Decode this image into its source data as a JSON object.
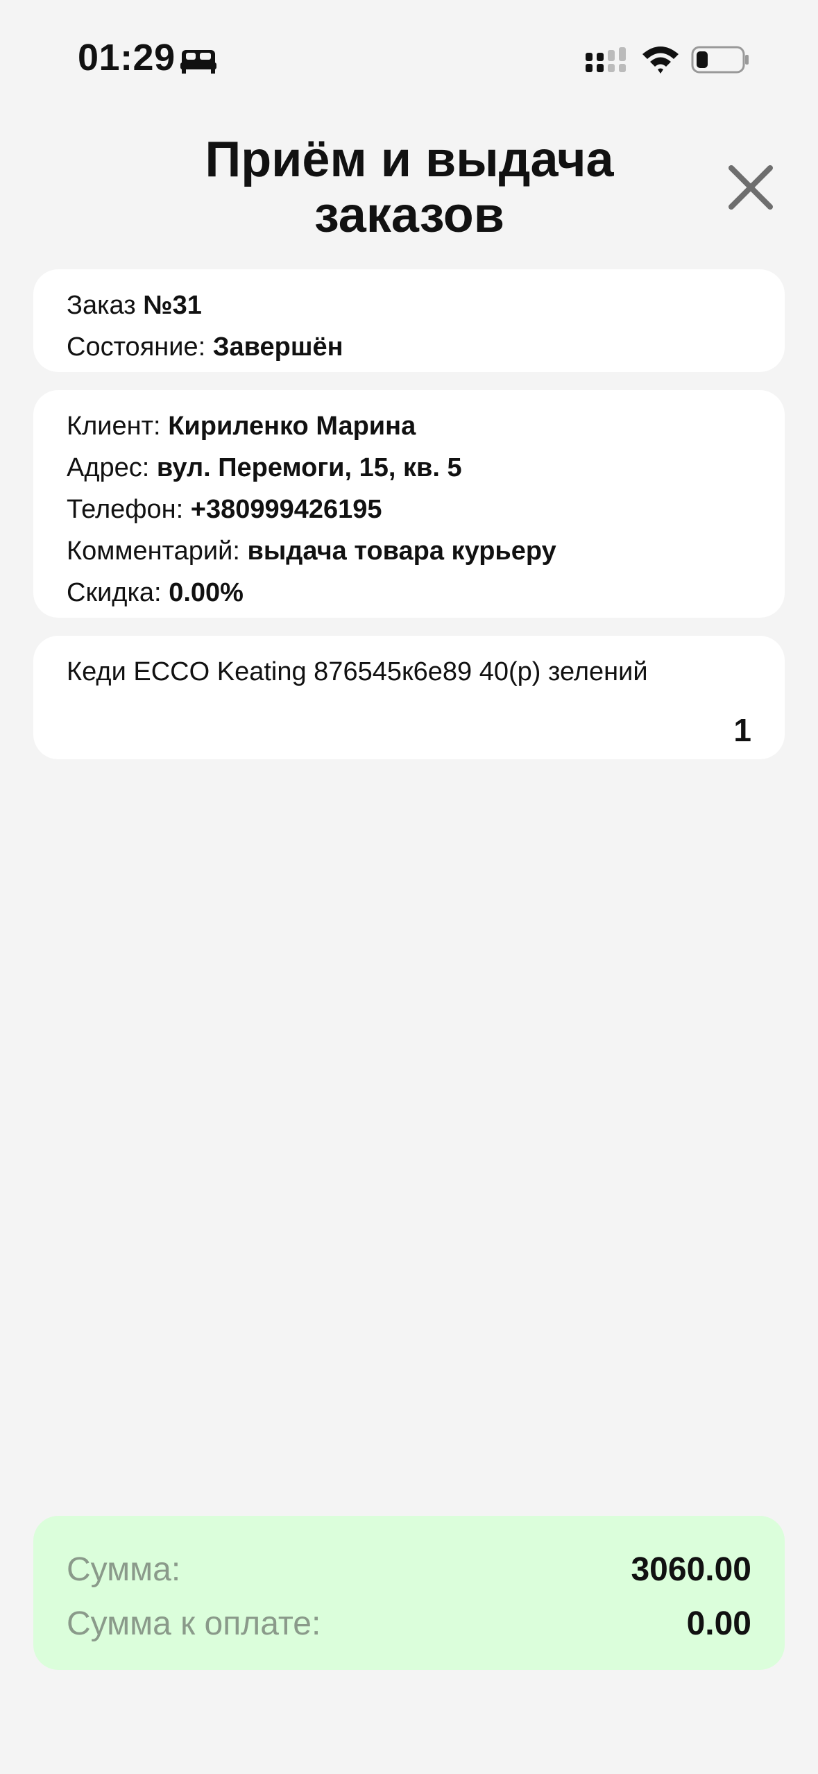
{
  "status_bar": {
    "time": "01:29",
    "icons": [
      "sleep-icon",
      "cellular-signal-icon",
      "wifi-icon",
      "battery-icon"
    ]
  },
  "header": {
    "title_line1": "Приём и выдача",
    "title_line2": "заказов",
    "close_icon": "close-icon"
  },
  "order": {
    "number_label": "Заказ",
    "number_value": "№31",
    "state_label": "Состояние:",
    "state_value": "Завершён"
  },
  "client": {
    "name_label": "Клиент:",
    "name_value": "Кириленко Марина",
    "address_label": "Адрес:",
    "address_value": "вул. Перемоги, 15, кв. 5",
    "phone_label": "Телефон:",
    "phone_value": "+380999426195",
    "comment_label": "Комментарий:",
    "comment_value": "выдача товара курьеру",
    "discount_label": "Скидка:",
    "discount_value": "0.00%"
  },
  "items": [
    {
      "name": "Кеди ECCO Keating 876545к6е89 40(р) зелений",
      "quantity": "1"
    }
  ],
  "summary": {
    "total_label": "Сумма:",
    "total_value": "3060.00",
    "to_pay_label": "Сумма к оплате:",
    "to_pay_value": "0.00"
  },
  "colors": {
    "background": "#f4f4f4",
    "card": "#ffffff",
    "summary_bg": "#dbfedb",
    "summary_label": "#8a9a8a",
    "close_icon": "#6e6e6e"
  }
}
